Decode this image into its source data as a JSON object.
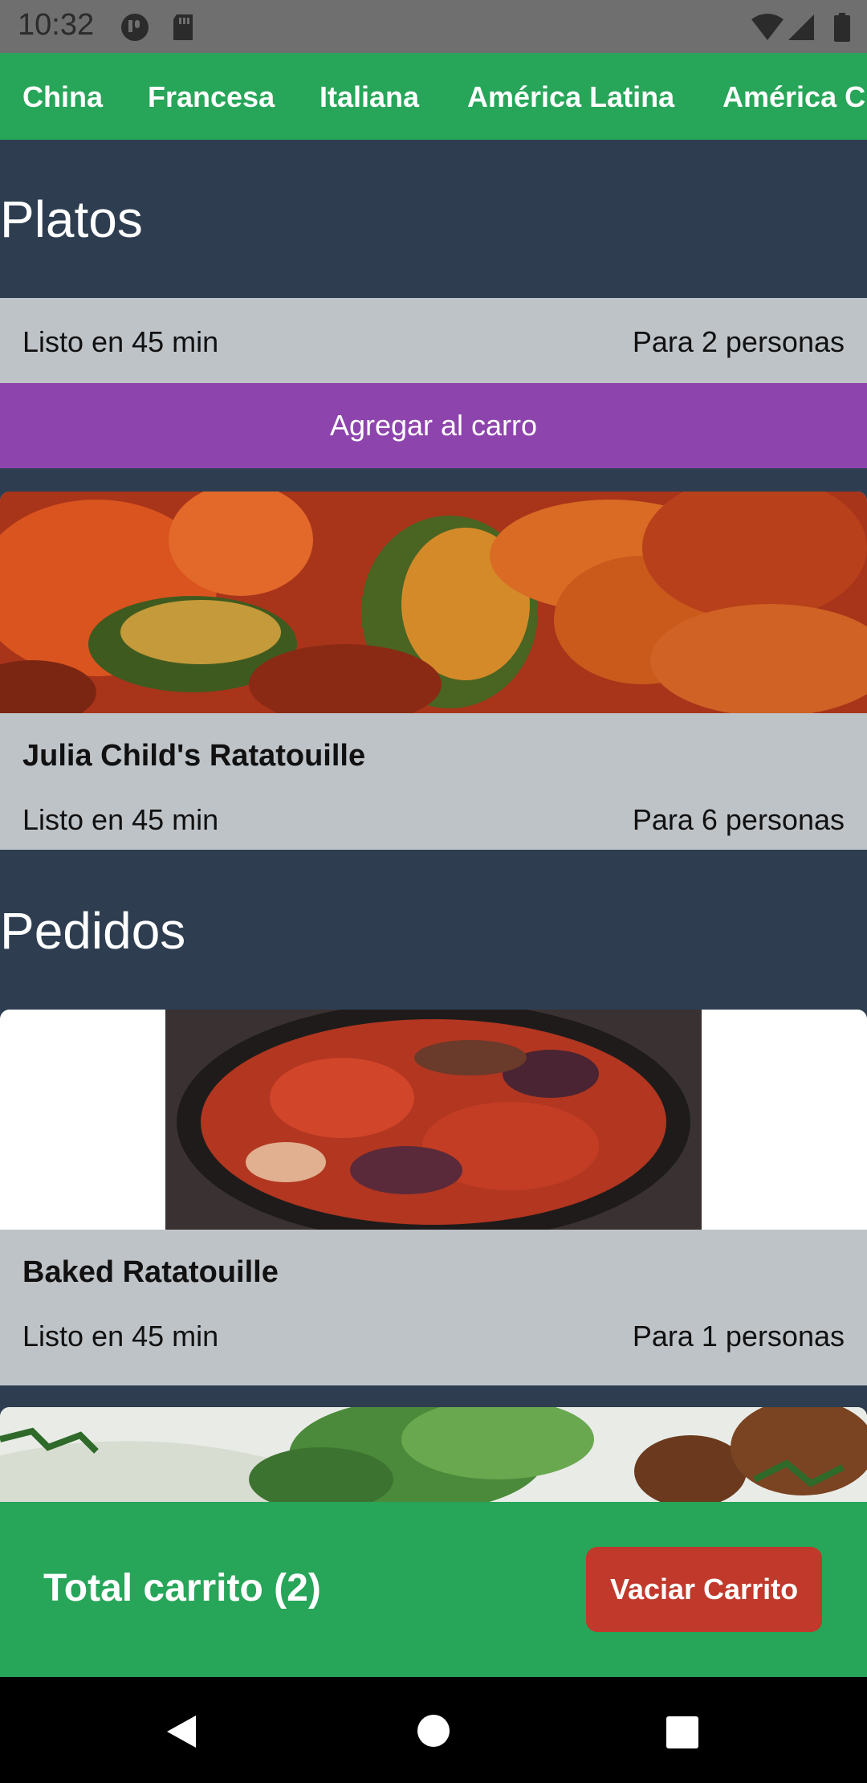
{
  "status_bar": {
    "time": "10:32"
  },
  "categories": [
    "China",
    "Francesa",
    "Italiana",
    "América Latina",
    "América C"
  ],
  "sections": {
    "platos": "Platos",
    "pedidos": "Pedidos"
  },
  "featured": {
    "ready": "Listo en 45 min",
    "servings": "Para 2 personas",
    "add_label": "Agregar al carro"
  },
  "dish_card": {
    "title": "Julia Child's Ratatouille",
    "ready": "Listo en 45 min",
    "servings": "Para 6 personas"
  },
  "orders": [
    {
      "title": "Baked Ratatouille",
      "ready": "Listo en 45 min",
      "servings": "Para 1 personas"
    }
  ],
  "cart": {
    "total_label": "Total carrito (2)",
    "clear_label": "Vaciar Carrito"
  },
  "colors": {
    "nav_green": "#27a559",
    "background": "#2e3e50",
    "card": "#bec3c8",
    "purple": "#8e44ad",
    "red": "#c0392b"
  }
}
